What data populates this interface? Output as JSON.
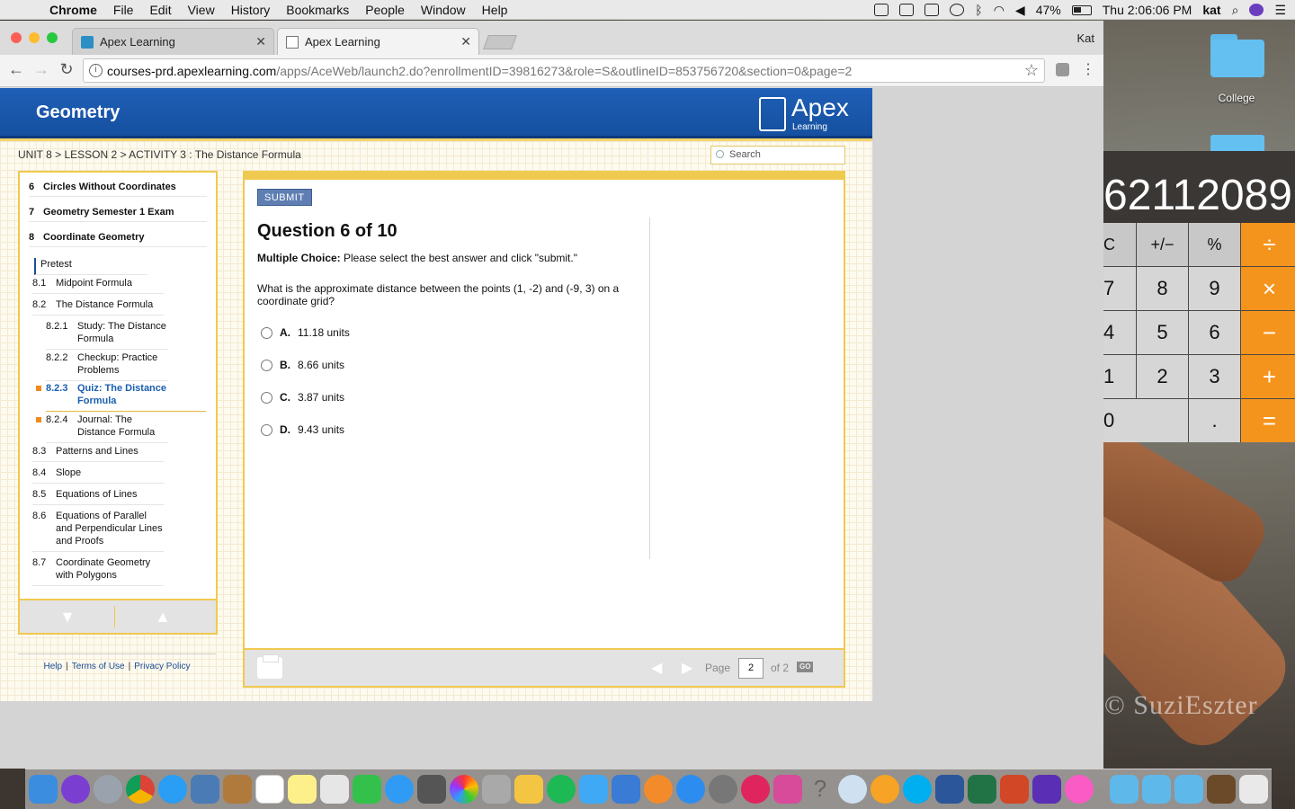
{
  "menubar": {
    "app": "Chrome",
    "items": [
      "File",
      "Edit",
      "View",
      "History",
      "Bookmarks",
      "People",
      "Window",
      "Help"
    ],
    "battery": "47%",
    "clock": "Thu 2:06:06 PM",
    "user": "kat"
  },
  "desktop": {
    "folder_label": "College",
    "watermark": "© SuziEszter"
  },
  "calculator": {
    "display": "62112089",
    "keys": [
      "C",
      "+/−",
      "%",
      "÷",
      "7",
      "8",
      "9",
      "×",
      "4",
      "5",
      "6",
      "−",
      "1",
      "2",
      "3",
      "+",
      "0",
      ".",
      "="
    ]
  },
  "browser": {
    "tabs": [
      {
        "title": "Apex Learning",
        "active": false
      },
      {
        "title": "Apex Learning",
        "active": true
      }
    ],
    "profile": "Kat",
    "url_host": "courses-prd.apexlearning.com",
    "url_path": "/apps/AceWeb/launch2.do?enrollmentID=39816273&role=S&outlineID=853756720&section=0&page=2"
  },
  "apex": {
    "course_title": "Geometry",
    "logo_name": "Apex",
    "logo_sub": "Learning",
    "breadcrumb": "UNIT 8 > LESSON 2 > ACTIVITY 3 : The Distance Formula",
    "search_placeholder": "Search"
  },
  "sidebar": {
    "units": [
      {
        "num": "6",
        "title": "Circles Without Coordinates"
      },
      {
        "num": "7",
        "title": "Geometry Semester 1 Exam"
      },
      {
        "num": "8",
        "title": "Coordinate Geometry"
      }
    ],
    "pretest": "Pretest",
    "lessons": [
      {
        "num": "8.1",
        "title": "Midpoint Formula"
      },
      {
        "num": "8.2",
        "title": "The Distance Formula"
      },
      {
        "num": "8.2.1",
        "title": "Study: The Distance Formula"
      },
      {
        "num": "8.2.2",
        "title": "Checkup: Practice Problems"
      },
      {
        "num": "8.2.3",
        "title": "Quiz: The Distance Formula"
      },
      {
        "num": "8.2.4",
        "title": "Journal: The Distance Formula"
      },
      {
        "num": "8.3",
        "title": "Patterns and Lines"
      },
      {
        "num": "8.4",
        "title": "Slope"
      },
      {
        "num": "8.5",
        "title": "Equations of Lines"
      },
      {
        "num": "8.6",
        "title": "Equations of Parallel and Perpendicular Lines and Proofs"
      },
      {
        "num": "8.7",
        "title": "Coordinate Geometry with Polygons"
      }
    ]
  },
  "footer": {
    "help": "Help",
    "terms": "Terms of Use",
    "privacy": "Privacy Policy"
  },
  "question": {
    "submit_label": "SUBMIT",
    "title": "Question 6 of 10",
    "instr_bold": "Multiple Choice:",
    "instr_text": " Please select the best answer and click \"submit.\"",
    "text": "What is the approximate distance between the points (1, -2) and (-9, 3) on a coordinate grid?",
    "choices": [
      {
        "letter": "A.",
        "text": "11.18 units"
      },
      {
        "letter": "B.",
        "text": "8.66 units"
      },
      {
        "letter": "C.",
        "text": "3.87 units"
      },
      {
        "letter": "D.",
        "text": "9.43 units"
      }
    ]
  },
  "pager": {
    "page_label": "Page",
    "page_value": "2",
    "of_label": "of 2",
    "go_label": "GO"
  }
}
